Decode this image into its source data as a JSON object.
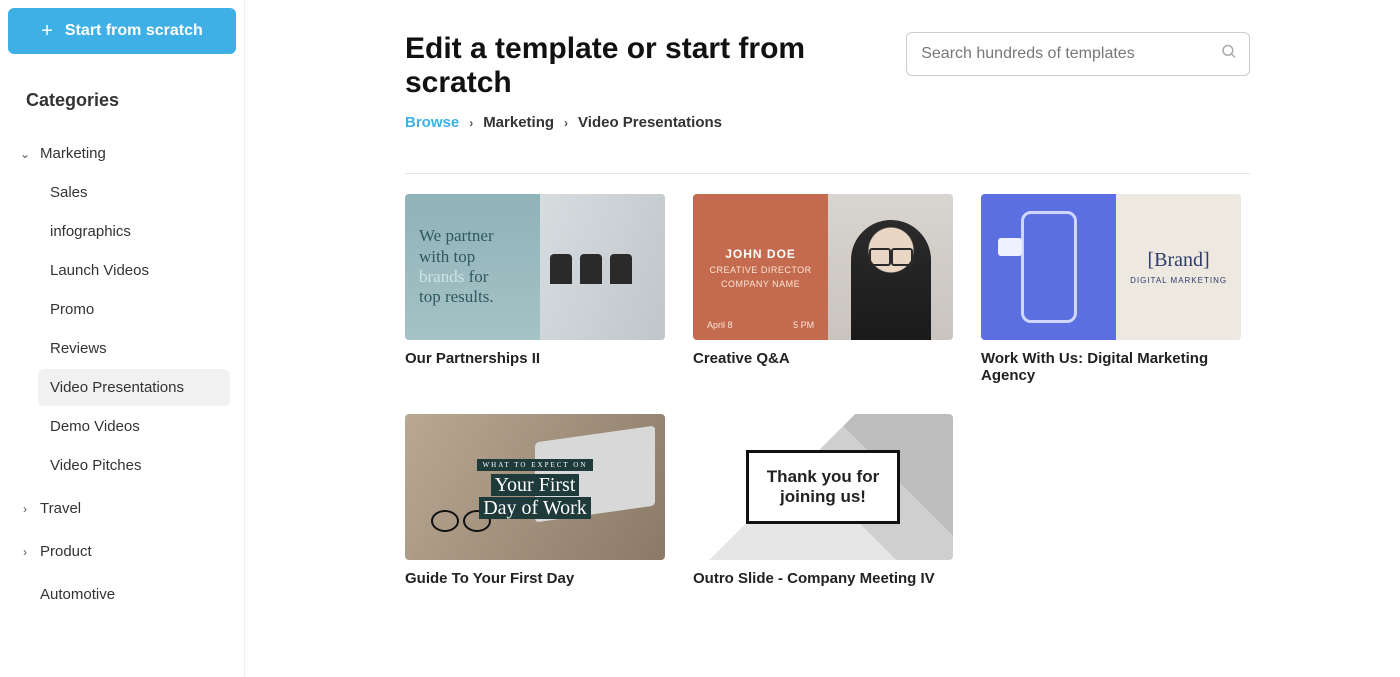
{
  "sidebar": {
    "start_label": "Start from scratch",
    "categories_title": "Categories",
    "groups": [
      {
        "label": "Marketing",
        "expanded": true,
        "items": [
          {
            "label": "Sales",
            "active": false
          },
          {
            "label": "infographics",
            "active": false
          },
          {
            "label": "Launch Videos",
            "active": false
          },
          {
            "label": "Promo",
            "active": false
          },
          {
            "label": "Reviews",
            "active": false
          },
          {
            "label": "Video Presentations",
            "active": true
          },
          {
            "label": "Demo Videos",
            "active": false
          },
          {
            "label": "Video Pitches",
            "active": false
          }
        ]
      },
      {
        "label": "Travel",
        "expanded": false,
        "items": []
      },
      {
        "label": "Product",
        "expanded": false,
        "items": []
      },
      {
        "label": "Automotive",
        "expanded": false,
        "items": []
      }
    ]
  },
  "header": {
    "title": "Edit a template or start from scratch",
    "search_placeholder": "Search hundreds of templates"
  },
  "breadcrumb": {
    "root": "Browse",
    "level1": "Marketing",
    "level2": "Video Presentations"
  },
  "templates": [
    {
      "title": "Our Partnerships II",
      "thumb": {
        "line1": "We partner",
        "line2": "with top",
        "line3a": "brands",
        "line3b": "for",
        "line4": "top results."
      }
    },
    {
      "title": "Creative Q&A",
      "thumb": {
        "name": "JOHN DOE",
        "role1": "CREATIVE DIRECTOR",
        "role2": "COMPANY NAME",
        "date": "April 8",
        "time": "5 PM"
      }
    },
    {
      "title": "Work With Us: Digital Marketing Agency",
      "thumb": {
        "brand": "[Brand]",
        "sub": "DIGITAL MARKETING"
      }
    },
    {
      "title": "Guide To Your First Day",
      "thumb": {
        "small": "WHAT TO EXPECT ON",
        "big1": "Your First",
        "big2": "Day of Work"
      }
    },
    {
      "title": "Outro Slide - Company Meeting IV",
      "thumb": {
        "line1": "Thank you for",
        "line2": "joining us!"
      }
    }
  ]
}
